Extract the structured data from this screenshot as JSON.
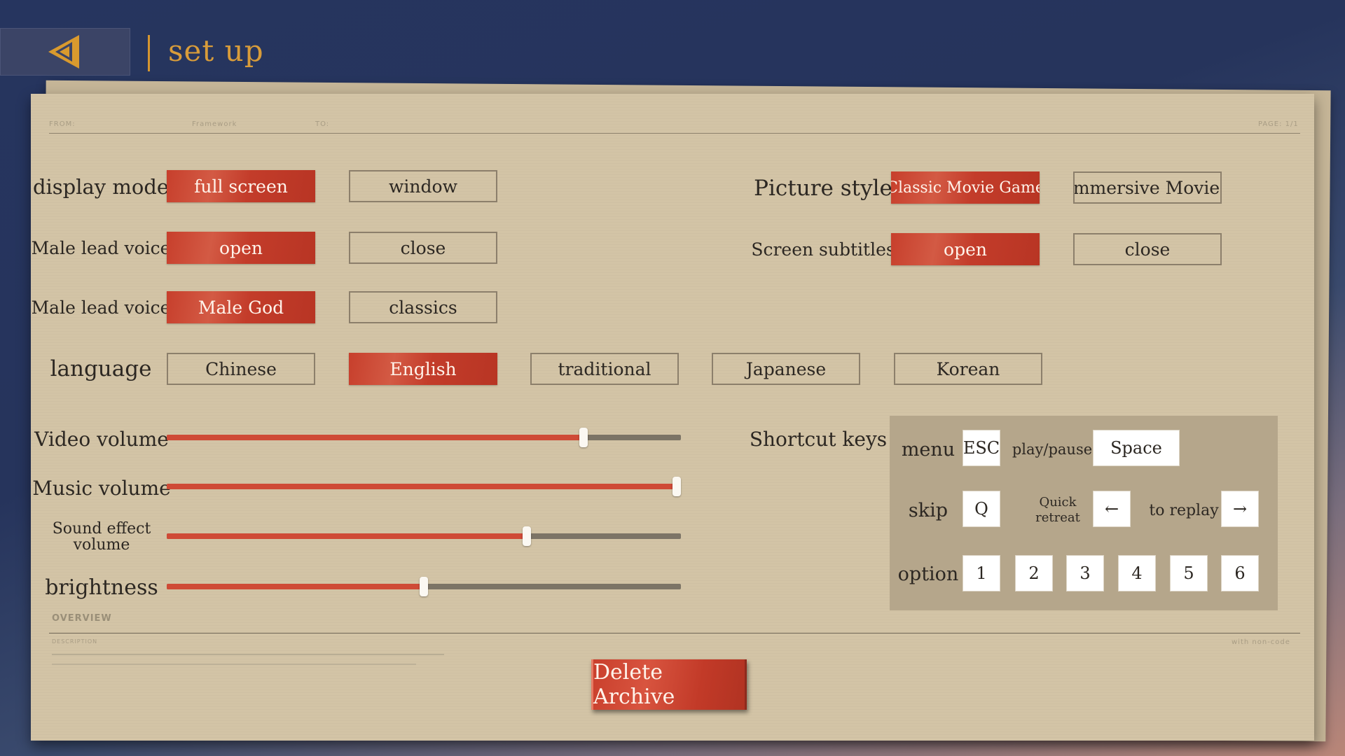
{
  "header": {
    "title": "set up"
  },
  "colors": {
    "accent": "#cf4a36",
    "title": "#d89c3a",
    "paper": "#d3c4a6"
  },
  "settings": {
    "display_mode": {
      "label": "display mode",
      "options": [
        "full screen",
        "window"
      ],
      "selected": "full screen"
    },
    "male_lead_voice": {
      "label": "Male lead voice",
      "options": [
        "open",
        "close"
      ],
      "selected": "open"
    },
    "male_lead_voice_type": {
      "label": "Male lead voice",
      "options": [
        "Male God",
        "classics"
      ],
      "selected": "Male God"
    },
    "language": {
      "label": "language",
      "options": [
        "Chinese",
        "English",
        "traditional",
        "Japanese",
        "Korean"
      ],
      "selected": "English"
    },
    "picture_style": {
      "label": "Picture style",
      "options": [
        "Classic Movie Game",
        "Immersive Movies"
      ],
      "selected": "Classic Movie Game"
    },
    "screen_subtitles": {
      "label": "Screen subtitles",
      "options": [
        "open",
        "close"
      ],
      "selected": "open"
    }
  },
  "sliders": {
    "video_volume": {
      "label": "Video volume",
      "value": 0.81
    },
    "music_volume": {
      "label": "Music volume",
      "value": 1.0
    },
    "sound_effect_volume": {
      "label": "Sound effect volume",
      "value": 0.7
    },
    "brightness": {
      "label": "brightness",
      "value": 0.5
    }
  },
  "shortcuts": {
    "label": "Shortcut keys",
    "menu": {
      "label": "menu",
      "key": "ESC"
    },
    "play_pause": {
      "label": "play/pause",
      "key": "Space"
    },
    "skip": {
      "label": "skip",
      "key": "Q"
    },
    "quick_retreat": {
      "label": "Quick retreat",
      "key": "←"
    },
    "replay": {
      "label": "to replay",
      "key": "→"
    },
    "option": {
      "label": "option",
      "keys": [
        "1",
        "2",
        "3",
        "4",
        "5",
        "6"
      ]
    }
  },
  "delete_archive": {
    "label": "Delete Archive"
  },
  "paper_print": {
    "from": "FROM:",
    "framework": "Framework",
    "to": "TO:",
    "page": "PAGE: 1/1",
    "overview": "OVERVIEW",
    "description": "DESCRIPTION",
    "with_code": "with non-code"
  },
  "icons": {
    "back": "back-arrow-icon"
  }
}
